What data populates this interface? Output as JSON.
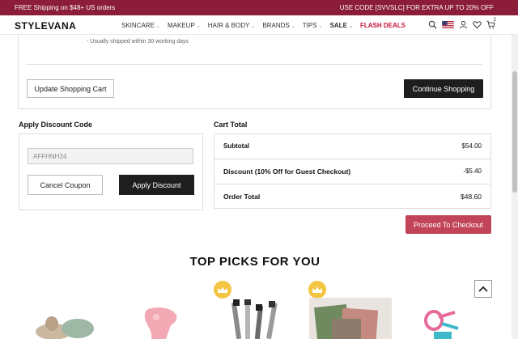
{
  "promo": {
    "left_text": "FREE Shipping on $48+ US orders",
    "right_text": "USE CODE [SVVSLC] FOR EXTRA UP TO 20% OFF"
  },
  "nav": {
    "logo": "STYLEVANA",
    "items": [
      {
        "label": "SKINCARE",
        "has_chevron": true
      },
      {
        "label": "MAKEUP",
        "has_chevron": true
      },
      {
        "label": "HAIR & BODY",
        "has_chevron": true
      },
      {
        "label": "BRANDS",
        "has_chevron": true
      },
      {
        "label": "TIPS",
        "has_chevron": true
      },
      {
        "label": "SALE",
        "has_chevron": true
      },
      {
        "label": "FLASH DEALS",
        "has_chevron": false
      }
    ],
    "cart_count": "2",
    "icons": [
      "search-icon",
      "us-flag-icon",
      "user-icon",
      "heart-icon",
      "cart-icon"
    ]
  },
  "cart": {
    "shipping_note": "- Usually shipped within 30 working days",
    "update_label": "Update Shopping Cart",
    "continue_label": "Continue Shopping"
  },
  "discount": {
    "heading": "Apply Discount Code",
    "code_value": "AFFHNH24",
    "cancel_label": "Cancel Coupon",
    "apply_label": "Apply Discount"
  },
  "totals": {
    "heading": "Cart Total",
    "rows": [
      {
        "label": "Subtotal",
        "value": "$54.00"
      },
      {
        "label": "Discount (10% Off for Guest Checkout)",
        "value": "-$5.40"
      },
      {
        "label": "Order Total",
        "value": "$48.60"
      }
    ],
    "checkout_label": "Proceed To Checkout"
  },
  "picks": {
    "title": "TOP PICKS FOR YOU"
  },
  "colors": {
    "promo_bg": "#8b1d3a",
    "sale_red": "#c4173a",
    "checkout_pink": "#c24459",
    "crown_gold": "#f4c542"
  }
}
